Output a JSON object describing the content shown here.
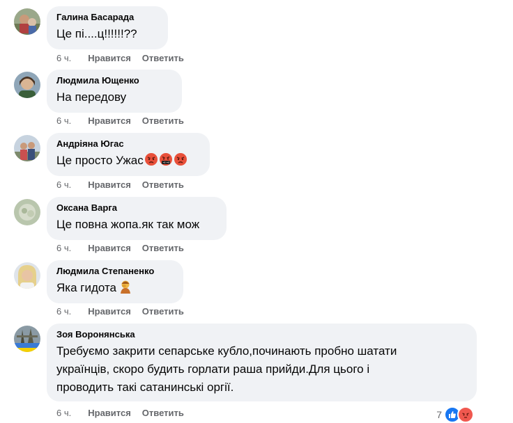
{
  "comments": [
    {
      "author": "Галина Басарада",
      "text": "Це пі....ц!!!!!!??",
      "time": "6 ч.",
      "like": "Нравится",
      "reply": "Ответить"
    },
    {
      "author": "Людмила Ющенко",
      "text": "На передову",
      "time": "6 ч.",
      "like": "Нравится",
      "reply": "Ответить"
    },
    {
      "author": "Андріяна Югас",
      "text": "Це просто Ужас",
      "time": "6 ч.",
      "like": "Нравится",
      "reply": "Ответить",
      "emojis": [
        "angry-face-emoji",
        "cursing-face-emoji",
        "angry-face-emoji"
      ]
    },
    {
      "author": "Оксана Варга",
      "text": "Це повна жопа.як так мож",
      "time": "6 ч.",
      "like": "Нравится",
      "reply": "Ответить"
    },
    {
      "author": "Людмила Степаненко",
      "text": "Яка гидота",
      "time": "6 ч.",
      "like": "Нравится",
      "reply": "Ответить",
      "emojis": [
        "person-facepalming-emoji"
      ]
    },
    {
      "author": "Зоя Воронянська",
      "text_lines": [
        "Требуємо закрити сепарське кубло,починають пробно шатати",
        "українців, скоро будить горлати раша прийди.Для цього і",
        "проводить такі сатанинські оргії."
      ],
      "time": "6 ч.",
      "like": "Нравится",
      "reply": "Ответить",
      "reaction_count": "7",
      "reactions": [
        "like-reaction-icon",
        "angry-reaction-icon"
      ]
    }
  ],
  "colors": {
    "bubble": "#f0f2f5",
    "meta": "#65676b",
    "like_blue": "#1877f2",
    "angry": "#f0584f"
  }
}
